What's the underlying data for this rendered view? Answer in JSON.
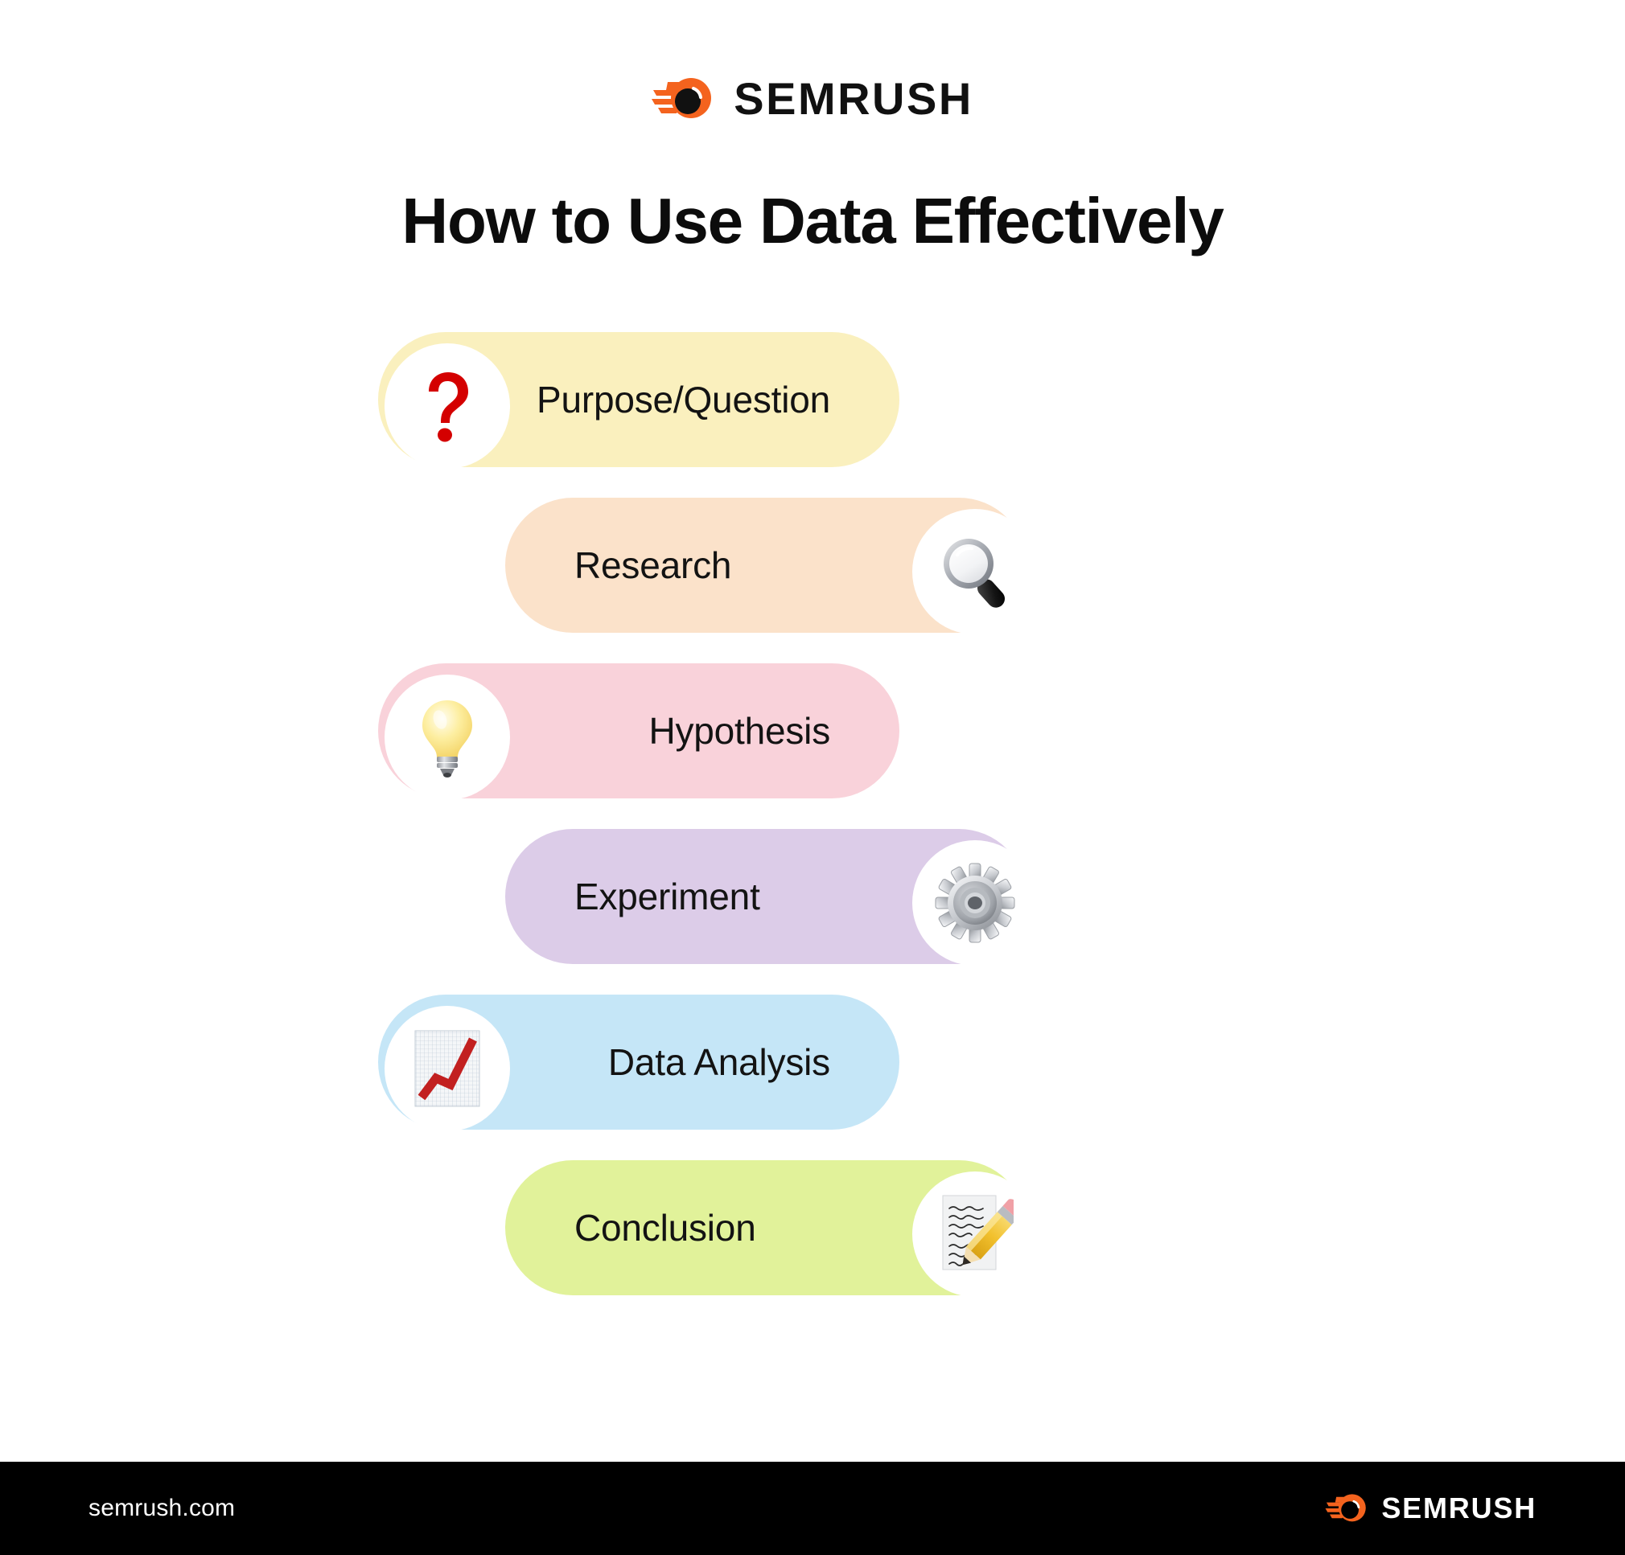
{
  "brand": {
    "name": "SEMRUSH",
    "logo_icon": "semrush-comet-icon",
    "accent_color": "#F4631E"
  },
  "header": {
    "logo_label": "SEMRUSH"
  },
  "title": "How to Use Data Effectively",
  "steps": [
    {
      "label": "Purpose/Question",
      "icon": "question-mark-icon",
      "icon_side": "left",
      "pill_color": "#FAF0BE"
    },
    {
      "label": "Research",
      "icon": "magnifying-glass-icon",
      "icon_side": "right",
      "pill_color": "#FBE2CA"
    },
    {
      "label": "Hypothesis",
      "icon": "light-bulb-icon",
      "icon_side": "left",
      "pill_color": "#F9D2DA"
    },
    {
      "label": "Experiment",
      "icon": "gear-icon",
      "icon_side": "right",
      "pill_color": "#DCCCE8"
    },
    {
      "label": "Data Analysis",
      "icon": "chart-increasing-icon",
      "icon_side": "left",
      "pill_color": "#C5E6F7"
    },
    {
      "label": "Conclusion",
      "icon": "memo-pencil-icon",
      "icon_side": "right",
      "pill_color": "#E1F29A"
    }
  ],
  "footer": {
    "url": "semrush.com",
    "logo_label": "SEMRUSH"
  }
}
